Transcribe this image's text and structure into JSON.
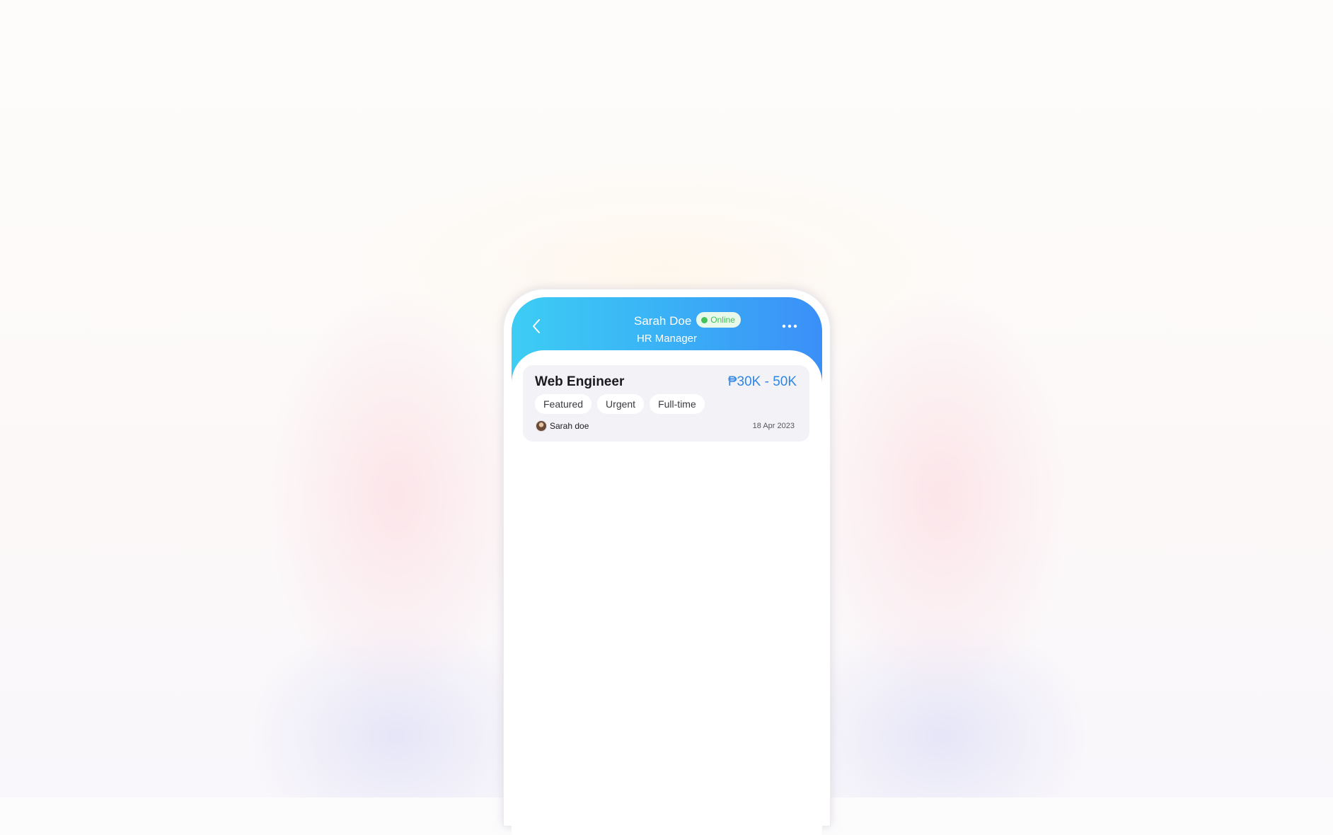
{
  "header": {
    "name": "Sarah Doe",
    "status": "Online",
    "role": "HR Manager",
    "back_icon": "chevron-left-icon",
    "more_icon": "more-horizontal-icon"
  },
  "job_card": {
    "title": "Web Engineer",
    "salary": "₱30K - 50K",
    "tags": [
      "Featured",
      "Urgent",
      "Full-time"
    ],
    "poster_name": "Sarah doe",
    "date": "18 Apr 2023"
  },
  "colors": {
    "header_gradient_start": "#3dcdf3",
    "header_gradient_end": "#3b8ff7",
    "salary": "#2f86e6",
    "online": "#44c55b",
    "card_bg": "#f3f3f7"
  }
}
